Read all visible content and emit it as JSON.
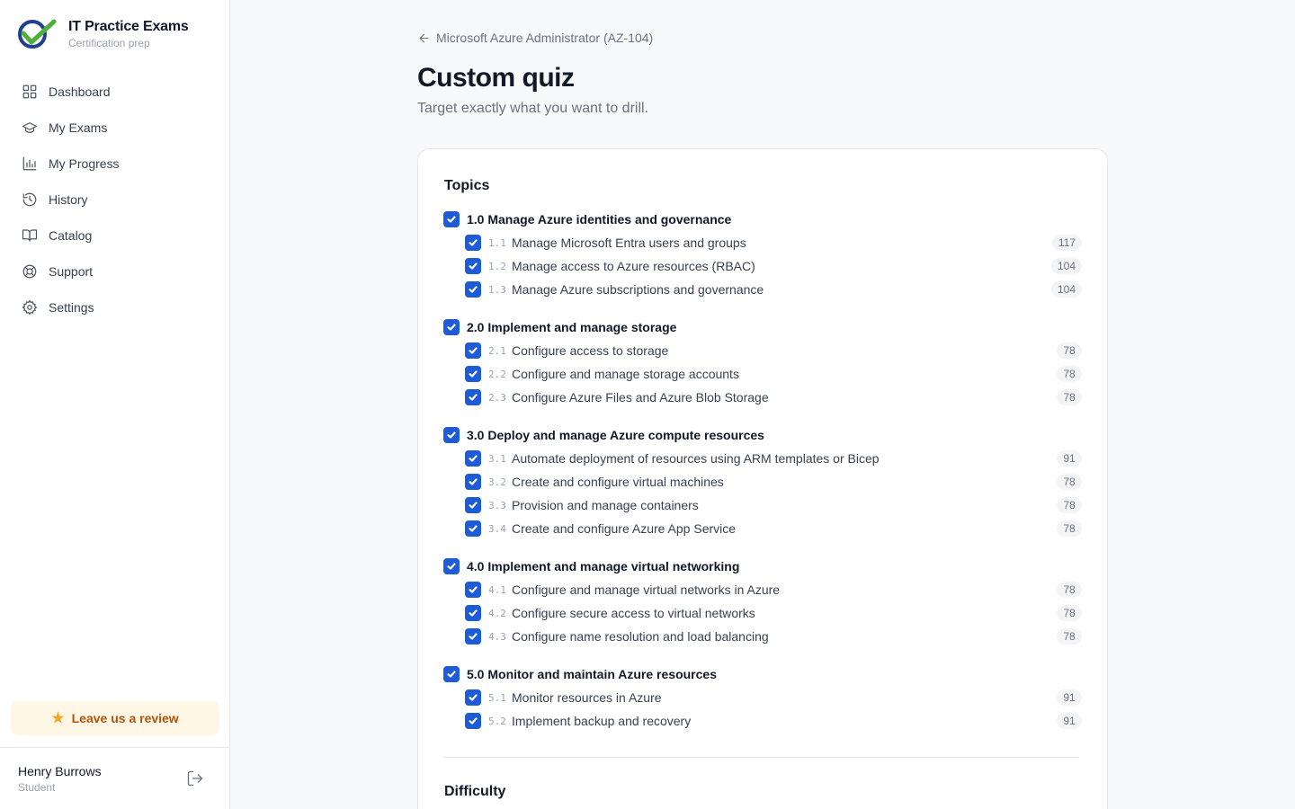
{
  "brand": {
    "title": "IT Practice Exams",
    "subtitle": "Certification prep"
  },
  "nav": [
    {
      "label": "Dashboard",
      "icon": "grid-icon"
    },
    {
      "label": "My Exams",
      "icon": "graduation-cap-icon"
    },
    {
      "label": "My Progress",
      "icon": "bar-chart-icon"
    },
    {
      "label": "History",
      "icon": "history-icon"
    },
    {
      "label": "Catalog",
      "icon": "book-open-icon"
    },
    {
      "label": "Support",
      "icon": "lifebuoy-icon"
    },
    {
      "label": "Settings",
      "icon": "gear-icon"
    }
  ],
  "review": {
    "label": "Leave us a review"
  },
  "user": {
    "name": "Henry Burrows",
    "role": "Student"
  },
  "header": {
    "back_label": "Microsoft Azure Administrator (AZ-104)",
    "title": "Custom quiz",
    "subtitle": "Target exactly what you want to drill."
  },
  "topics": {
    "title": "Topics",
    "groups": [
      {
        "label": "1.0 Manage Azure identities and governance",
        "checked": true,
        "items": [
          {
            "code": "1.1",
            "label": "Manage Microsoft Entra users and groups",
            "count": "117",
            "checked": true
          },
          {
            "code": "1.2",
            "label": "Manage access to Azure resources (RBAC)",
            "count": "104",
            "checked": true
          },
          {
            "code": "1.3",
            "label": "Manage Azure subscriptions and governance",
            "count": "104",
            "checked": true
          }
        ]
      },
      {
        "label": "2.0 Implement and manage storage",
        "checked": true,
        "items": [
          {
            "code": "2.1",
            "label": "Configure access to storage",
            "count": "78",
            "checked": true
          },
          {
            "code": "2.2",
            "label": "Configure and manage storage accounts",
            "count": "78",
            "checked": true
          },
          {
            "code": "2.3",
            "label": "Configure Azure Files and Azure Blob Storage",
            "count": "78",
            "checked": true
          }
        ]
      },
      {
        "label": "3.0 Deploy and manage Azure compute resources",
        "checked": true,
        "items": [
          {
            "code": "3.1",
            "label": "Automate deployment of resources using ARM templates or Bicep",
            "count": "91",
            "checked": true
          },
          {
            "code": "3.2",
            "label": "Create and configure virtual machines",
            "count": "78",
            "checked": true
          },
          {
            "code": "3.3",
            "label": "Provision and manage containers",
            "count": "78",
            "checked": true
          },
          {
            "code": "3.4",
            "label": "Create and configure Azure App Service",
            "count": "78",
            "checked": true
          }
        ]
      },
      {
        "label": "4.0 Implement and manage virtual networking",
        "checked": true,
        "items": [
          {
            "code": "4.1",
            "label": "Configure and manage virtual networks in Azure",
            "count": "78",
            "checked": true
          },
          {
            "code": "4.2",
            "label": "Configure secure access to virtual networks",
            "count": "78",
            "checked": true
          },
          {
            "code": "4.3",
            "label": "Configure name resolution and load balancing",
            "count": "78",
            "checked": true
          }
        ]
      },
      {
        "label": "5.0 Monitor and maintain Azure resources",
        "checked": true,
        "items": [
          {
            "code": "5.1",
            "label": "Monitor resources in Azure",
            "count": "91",
            "checked": true
          },
          {
            "code": "5.2",
            "label": "Implement backup and recovery",
            "count": "91",
            "checked": true
          }
        ]
      }
    ]
  },
  "difficulty": {
    "title": "Difficulty"
  },
  "colors": {
    "accent": "#1d5bd8",
    "review_bg": "#fef7e6",
    "review_text": "#b45309",
    "star": "#f5a524"
  }
}
